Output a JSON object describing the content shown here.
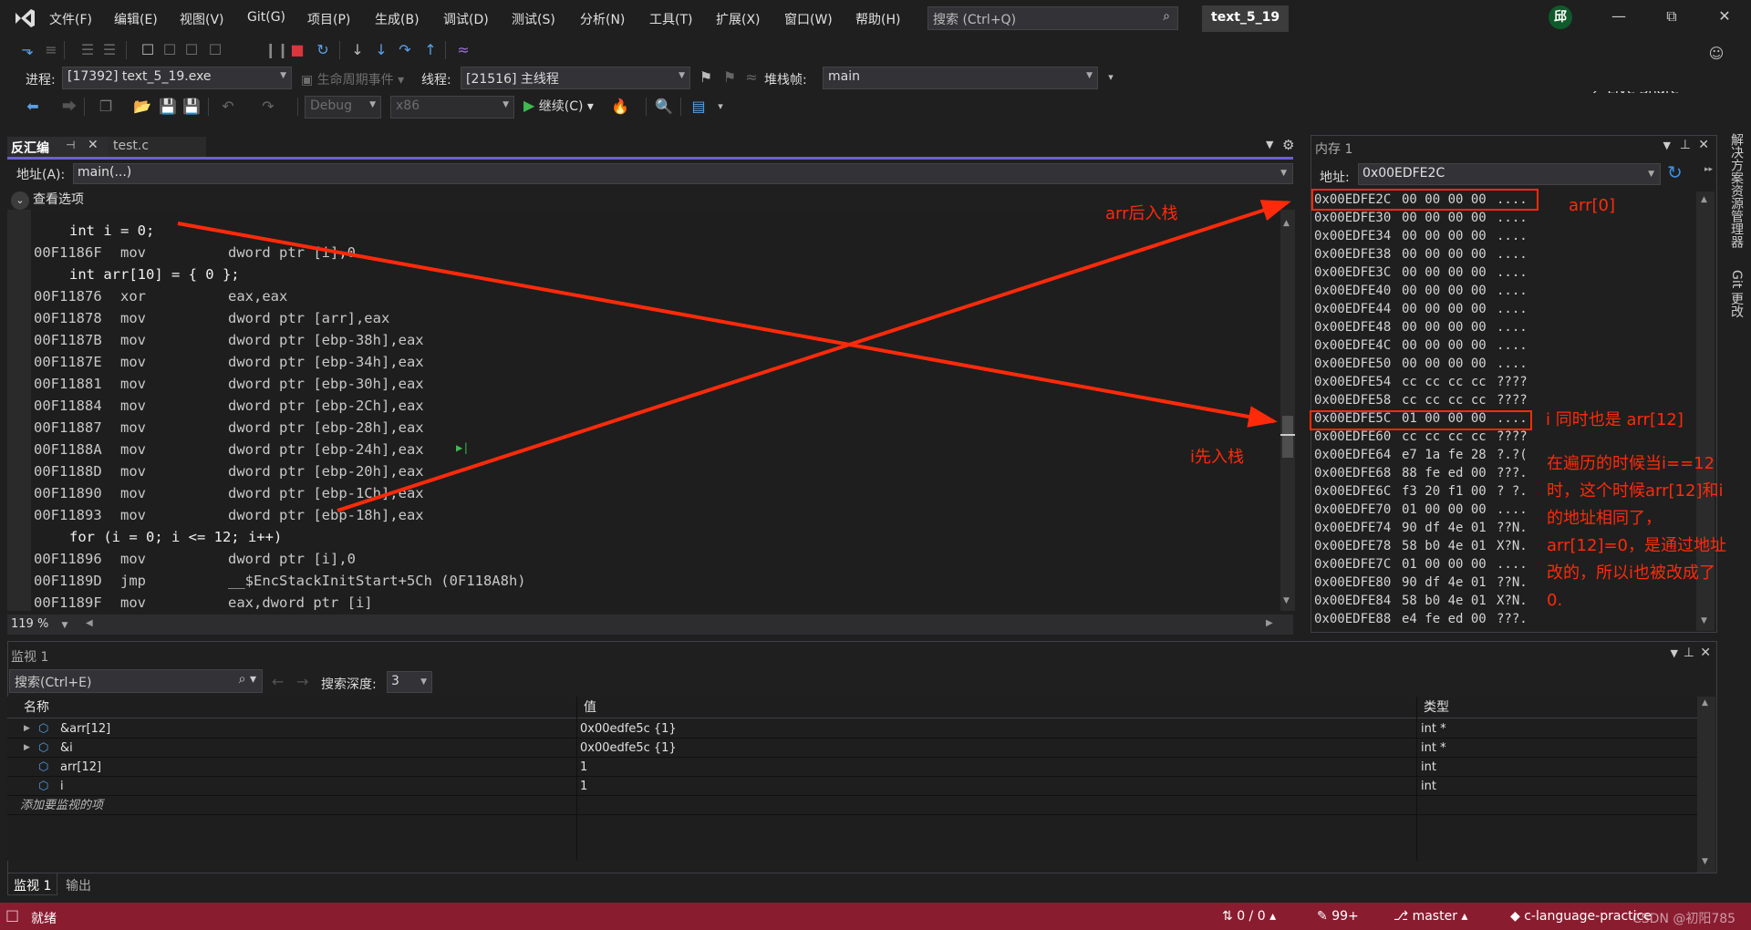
{
  "menu": {
    "items": [
      "文件(F)",
      "编辑(E)",
      "视图(V)",
      "Git(G)",
      "项目(P)",
      "生成(B)",
      "调试(D)",
      "测试(S)",
      "分析(N)",
      "工具(T)",
      "扩展(X)",
      "窗口(W)",
      "帮助(H)"
    ],
    "search_placeholder": "搜索 (Ctrl+Q)",
    "solution_name": "text_5_19",
    "avatar_initial": "邱",
    "live_share": "Live Share"
  },
  "debug_toolbar": {
    "process_label": "进程:",
    "process_value": "[17392] text_5_19.exe",
    "lifecycle_label": "生命周期事件",
    "thread_label": "线程:",
    "thread_value": "[21516] 主线程",
    "stackframe_label": "堆栈帧:",
    "stackframe_value": "main"
  },
  "std_toolbar": {
    "config": "Debug",
    "platform": "x86",
    "continue_label": "继续(C)"
  },
  "disassembly": {
    "tab_active": "反汇编",
    "tab_inactive": "test.c",
    "address_label": "地址(A):",
    "address_value": "main(...)",
    "view_options": "查看选项",
    "zoom": "119 %",
    "lines": [
      {
        "type": "src",
        "text": "int i = 0;"
      },
      {
        "type": "asm",
        "addr": "00F1186F",
        "op": "mov",
        "arg": "dword ptr [i],0"
      },
      {
        "type": "src",
        "text": "int arr[10] = { 0 };"
      },
      {
        "type": "asm",
        "addr": "00F11876",
        "op": "xor",
        "arg": "eax,eax"
      },
      {
        "type": "asm",
        "addr": "00F11878",
        "op": "mov",
        "arg": "dword ptr [arr],eax"
      },
      {
        "type": "asm",
        "addr": "00F1187B",
        "op": "mov",
        "arg": "dword ptr [ebp-38h],eax"
      },
      {
        "type": "asm",
        "addr": "00F1187E",
        "op": "mov",
        "arg": "dword ptr [ebp-34h],eax"
      },
      {
        "type": "asm",
        "addr": "00F11881",
        "op": "mov",
        "arg": "dword ptr [ebp-30h],eax"
      },
      {
        "type": "asm",
        "addr": "00F11884",
        "op": "mov",
        "arg": "dword ptr [ebp-2Ch],eax"
      },
      {
        "type": "asm",
        "addr": "00F11887",
        "op": "mov",
        "arg": "dword ptr [ebp-28h],eax"
      },
      {
        "type": "asm",
        "addr": "00F1188A",
        "op": "mov",
        "arg": "dword ptr [ebp-24h],eax"
      },
      {
        "type": "asm",
        "addr": "00F1188D",
        "op": "mov",
        "arg": "dword ptr [ebp-20h],eax"
      },
      {
        "type": "asm",
        "addr": "00F11890",
        "op": "mov",
        "arg": "dword ptr [ebp-1Ch],eax"
      },
      {
        "type": "asm",
        "addr": "00F11893",
        "op": "mov",
        "arg": "dword ptr [ebp-18h],eax"
      },
      {
        "type": "src",
        "text": "for (i = 0; i <= 12; i++)"
      },
      {
        "type": "asm",
        "addr": "00F11896",
        "op": "mov",
        "arg": "dword ptr [i],0"
      },
      {
        "type": "asm",
        "addr": "00F1189D",
        "op": "jmp",
        "arg": "__$EncStackInitStart+5Ch (0F118A8h)"
      },
      {
        "type": "asm",
        "addr": "00F1189F",
        "op": "mov",
        "arg": "eax,dword ptr [i]"
      }
    ]
  },
  "memory": {
    "title": "内存 1",
    "address_label": "地址:",
    "address_value": "0x00EDFE2C",
    "rows": [
      {
        "addr": "0x00EDFE2C",
        "bytes": "00 00 00 00",
        "chars": "...."
      },
      {
        "addr": "0x00EDFE30",
        "bytes": "00 00 00 00",
        "chars": "...."
      },
      {
        "addr": "0x00EDFE34",
        "bytes": "00 00 00 00",
        "chars": "...."
      },
      {
        "addr": "0x00EDFE38",
        "bytes": "00 00 00 00",
        "chars": "...."
      },
      {
        "addr": "0x00EDFE3C",
        "bytes": "00 00 00 00",
        "chars": "...."
      },
      {
        "addr": "0x00EDFE40",
        "bytes": "00 00 00 00",
        "chars": "...."
      },
      {
        "addr": "0x00EDFE44",
        "bytes": "00 00 00 00",
        "chars": "...."
      },
      {
        "addr": "0x00EDFE48",
        "bytes": "00 00 00 00",
        "chars": "...."
      },
      {
        "addr": "0x00EDFE4C",
        "bytes": "00 00 00 00",
        "chars": "...."
      },
      {
        "addr": "0x00EDFE50",
        "bytes": "00 00 00 00",
        "chars": "...."
      },
      {
        "addr": "0x00EDFE54",
        "bytes": "cc cc cc cc",
        "chars": "????"
      },
      {
        "addr": "0x00EDFE58",
        "bytes": "cc cc cc cc",
        "chars": "????"
      },
      {
        "addr": "0x00EDFE5C",
        "bytes": "01 00 00 00",
        "chars": "...."
      },
      {
        "addr": "0x00EDFE60",
        "bytes": "cc cc cc cc",
        "chars": "????"
      },
      {
        "addr": "0x00EDFE64",
        "bytes": "e7 1a fe 28",
        "chars": "?.?("
      },
      {
        "addr": "0x00EDFE68",
        "bytes": "88 fe ed 00",
        "chars": "???."
      },
      {
        "addr": "0x00EDFE6C",
        "bytes": "f3 20 f1 00",
        "chars": "? ?."
      },
      {
        "addr": "0x00EDFE70",
        "bytes": "01 00 00 00",
        "chars": "...."
      },
      {
        "addr": "0x00EDFE74",
        "bytes": "90 df 4e 01",
        "chars": "??N."
      },
      {
        "addr": "0x00EDFE78",
        "bytes": "58 b0 4e 01",
        "chars": "X?N."
      },
      {
        "addr": "0x00EDFE7C",
        "bytes": "01 00 00 00",
        "chars": "...."
      },
      {
        "addr": "0x00EDFE80",
        "bytes": "90 df 4e 01",
        "chars": "??N."
      },
      {
        "addr": "0x00EDFE84",
        "bytes": "58 b0 4e 01",
        "chars": "X?N."
      },
      {
        "addr": "0x00EDFE88",
        "bytes": "e4 fe ed 00",
        "chars": "???."
      }
    ]
  },
  "side_tabs": [
    "解决方案资源管理器",
    "Git 更改"
  ],
  "annotations": {
    "arr_pushed_later": "arr后入栈",
    "i_pushed_first": "i先入栈",
    "arr0": "arr[0]",
    "i_is_arr12": "i 同时也是 arr[12]",
    "explanation": "在遍历的时候当i==12时，这个时候arr[12]和i的地址相同了，arr[12]=0，是通过地址改的，所以i也被改成了0."
  },
  "watch": {
    "title": "监视 1",
    "search_placeholder": "搜索(Ctrl+E)",
    "depth_label": "搜索深度:",
    "depth_value": "3",
    "columns": [
      "名称",
      "值",
      "类型"
    ],
    "rows": [
      {
        "name": "&arr[12]",
        "value": "0x00edfe5c {1}",
        "type": "int *",
        "expandable": true
      },
      {
        "name": "&i",
        "value": "0x00edfe5c {1}",
        "type": "int *",
        "expandable": true
      },
      {
        "name": "arr[12]",
        "value": "1",
        "type": "int",
        "expandable": false
      },
      {
        "name": "i",
        "value": "1",
        "type": "int",
        "expandable": false
      }
    ],
    "add_item": "添加要监视的项",
    "bottom_tabs": [
      "监视 1",
      "输出"
    ]
  },
  "status": {
    "ready": "就绪",
    "sync": "0 / 0",
    "changes": "99+",
    "branch": "master",
    "repo": "c-language-practice",
    "watermark": "CSDN @初阳785"
  },
  "colors": {
    "accent": "#6c5fd8",
    "statusbar": "#8a1c30",
    "annotation": "#ff2a0a"
  }
}
